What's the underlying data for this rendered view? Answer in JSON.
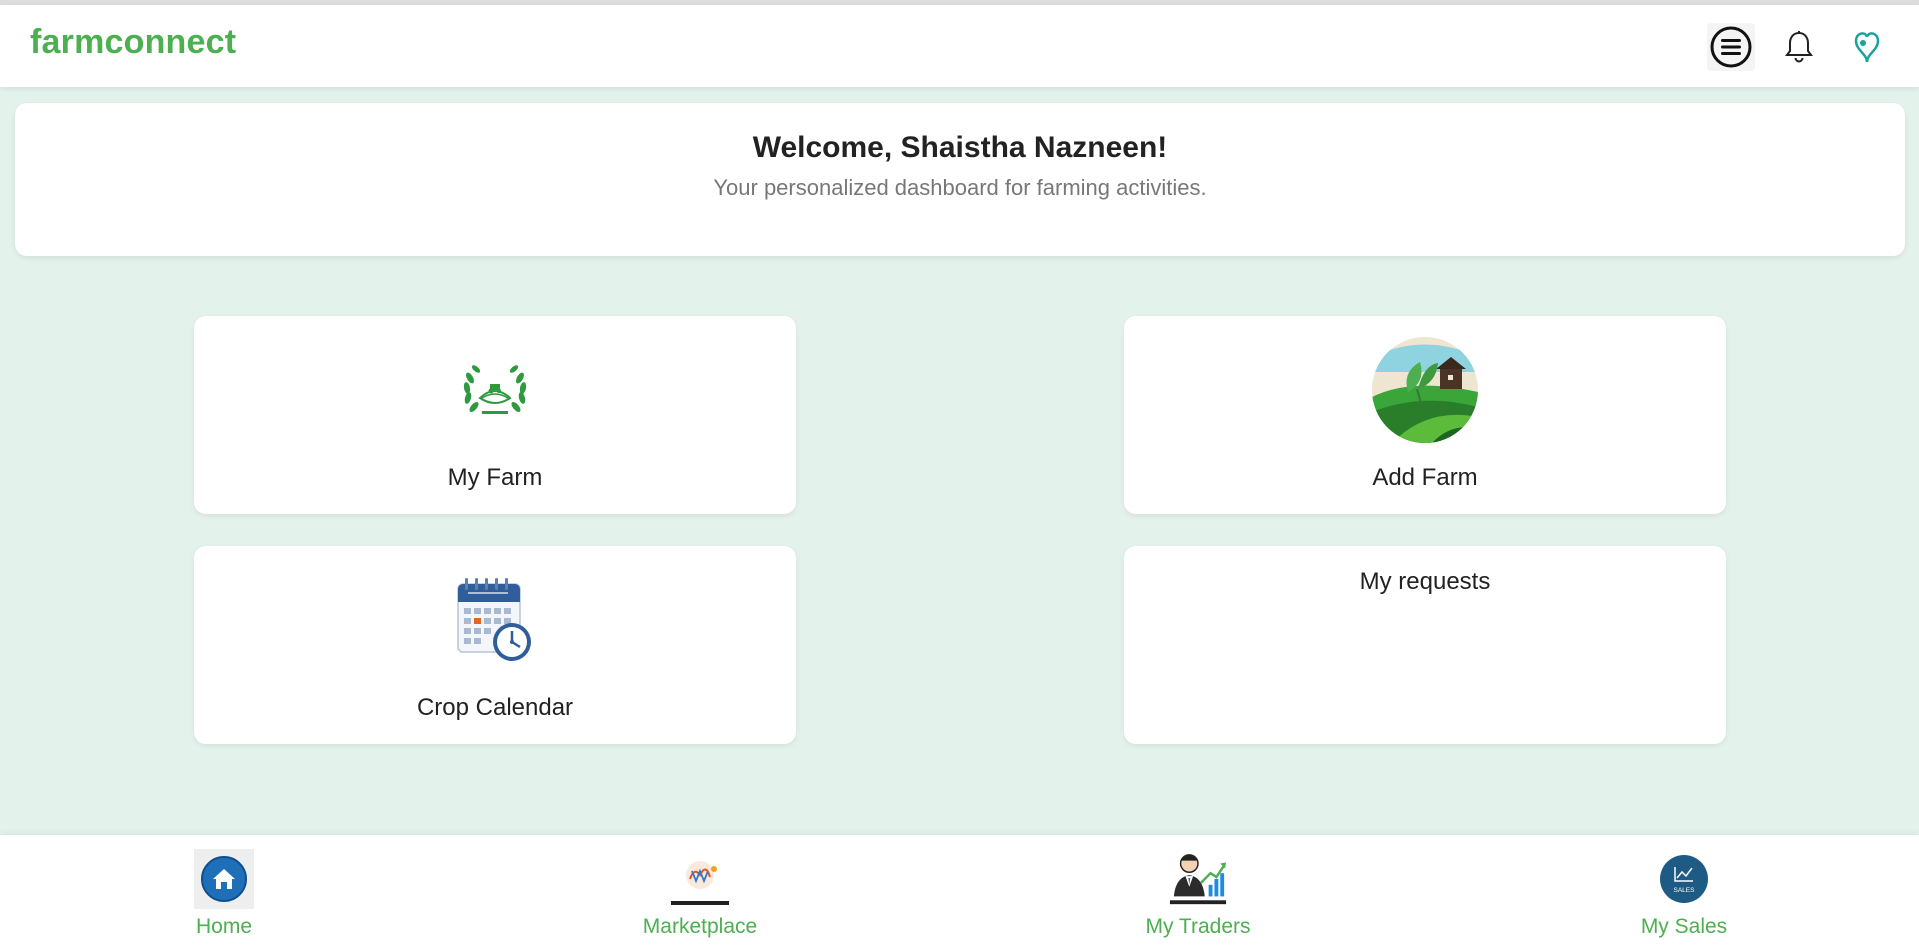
{
  "brand": {
    "name": "farmconnect",
    "color": "#4caf50"
  },
  "header": {
    "icons": [
      "menu-icon",
      "bell-icon",
      "brand-logo-icon"
    ]
  },
  "welcome": {
    "title": "Welcome, Shaistha Nazneen!",
    "subtitle": "Your personalized dashboard for farming activities."
  },
  "cards": {
    "my_farm": {
      "label": "My Farm",
      "icon": "agriculture-emblem-icon"
    },
    "add_farm": {
      "label": "Add Farm",
      "icon": "farm-landscape-icon"
    },
    "crop_calendar": {
      "label": "Crop Calendar",
      "icon": "calendar-clock-icon"
    },
    "my_requests": {
      "label": "My requests"
    }
  },
  "bottom_nav": {
    "home": {
      "label": "Home",
      "icon": "home-icon"
    },
    "marketplace": {
      "label": "Marketplace",
      "icon": "marketplace-icon"
    },
    "my_traders": {
      "label": "My Traders",
      "icon": "trader-chart-icon"
    },
    "my_sales": {
      "label": "My Sales",
      "icon": "sales-chart-icon"
    }
  },
  "colors": {
    "background": "#e4f2ec",
    "accent": "#4caf50"
  }
}
